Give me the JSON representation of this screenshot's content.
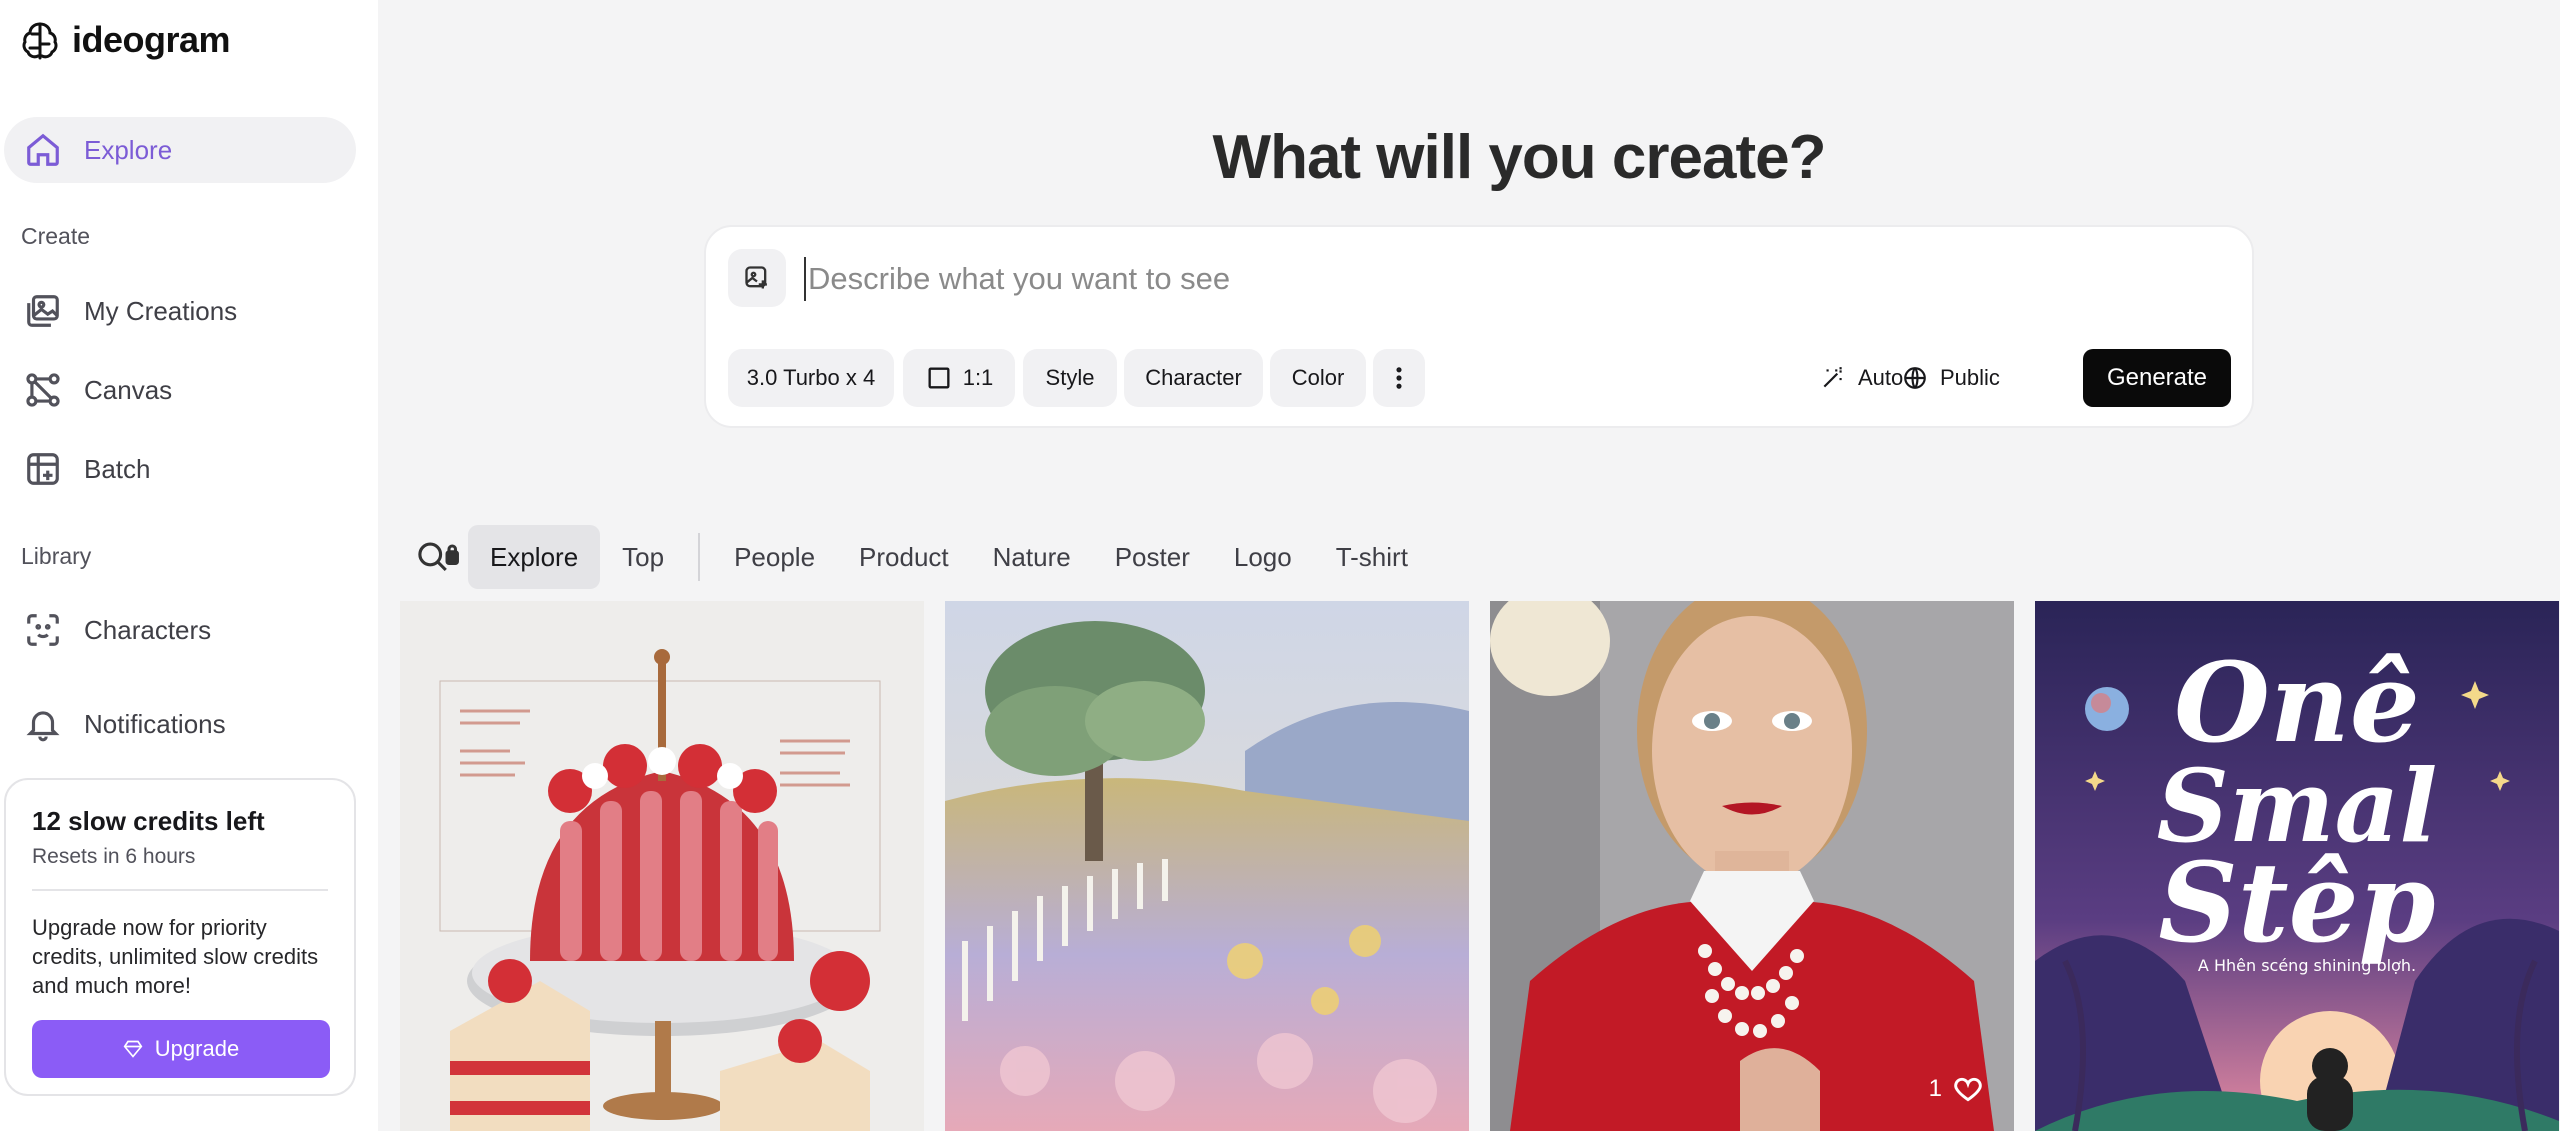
{
  "app": {
    "name": "ideogram"
  },
  "sidebar": {
    "explore": "Explore",
    "create_label": "Create",
    "create_items": [
      "My Creations",
      "Canvas",
      "Batch"
    ],
    "library_label": "Library",
    "library_items": [
      "Characters"
    ],
    "notifications": "Notifications"
  },
  "credits": {
    "title": "12 slow credits left",
    "reset": "Resets in 6 hours",
    "message": "Upgrade now for priority credits, unlimited slow credits and much more!",
    "upgrade_label": "Upgrade"
  },
  "hero": {
    "title": "What will you create?"
  },
  "prompt": {
    "placeholder": "Describe what you want to see",
    "value": "",
    "model": "3.0 Turbo x 4",
    "aspect_ratio": "1:1",
    "style": "Style",
    "character": "Character",
    "color": "Color",
    "magic_prompt": "Auto",
    "visibility": "Public",
    "generate": "Generate"
  },
  "filters": {
    "tabs": [
      "Explore",
      "Top",
      "People",
      "Product",
      "Nature",
      "Poster",
      "Logo",
      "T-shirt"
    ],
    "active": "Explore"
  },
  "gallery": {
    "tiles": [
      {
        "subject": "strawberry cake illustration"
      },
      {
        "subject": "impressionist meadow with tree"
      },
      {
        "subject": "portrait woman red sweater pearls",
        "likes": "1"
      },
      {
        "subject": "poster",
        "poster_line1": "Onê",
        "poster_line2": "Smal",
        "poster_line3": "Stêp",
        "poster_sub": "A Hhên scéng shining blợh."
      }
    ]
  },
  "colors": {
    "accent": "#8b5cf6",
    "active_nav": "#7c5cd6",
    "generate_bg": "#0a0a0a"
  }
}
